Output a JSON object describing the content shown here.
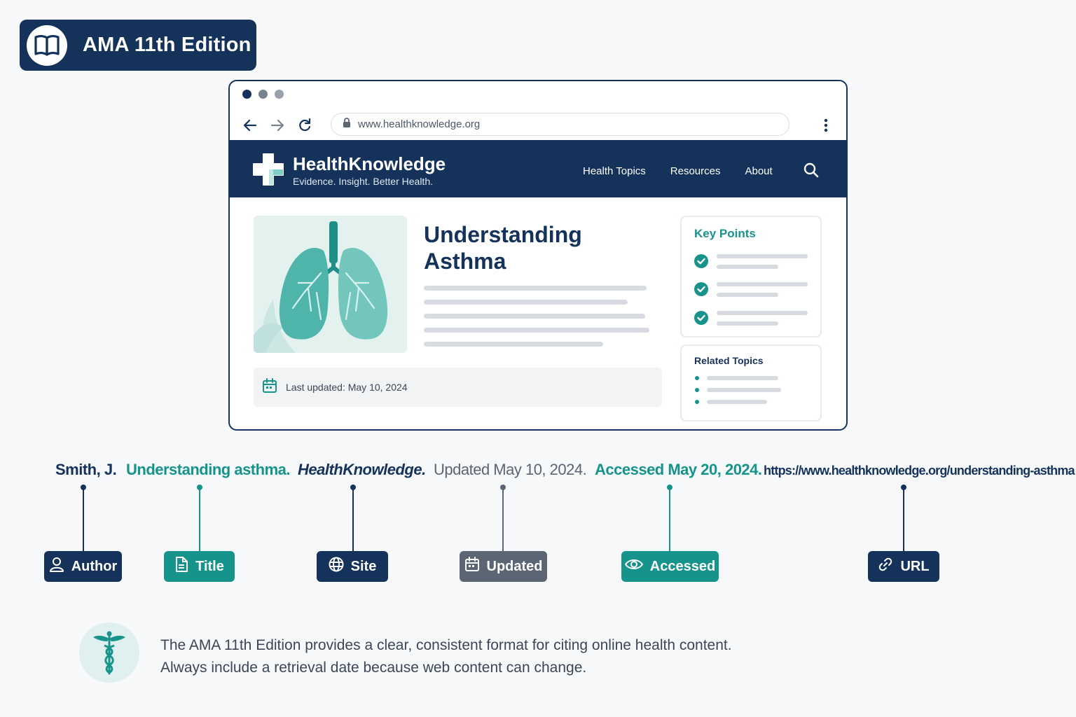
{
  "edition_badge": {
    "title": "AMA 11th Edition",
    "icon": "open-book-icon"
  },
  "browser": {
    "address": "www.healthknowledge.org",
    "icons": [
      "back-arrow-icon",
      "forward-arrow-icon",
      "reload-icon",
      "lock-icon",
      "more-vertical-icon"
    ]
  },
  "site": {
    "name": "HealthKnowledge",
    "tagline": "Evidence. Insight. Better Health.",
    "nav": [
      "Health Topics",
      "Resources",
      "About"
    ]
  },
  "article": {
    "title": "Understanding Asthma",
    "last_updated": "Last updated: May 10, 2024"
  },
  "sidebar": {
    "key_points_title": "Key Points",
    "related_topics_title": "Related Topics"
  },
  "citation": {
    "author": "Smith, J.",
    "title": "Understanding asthma.",
    "site": "HealthKnowledge.",
    "updated": "Updated May 10, 2024.",
    "accessed": "Accessed May 20, 2024.",
    "url": "https://www.healthknowledge.org/understanding-asthma"
  },
  "tags": {
    "author": "Author",
    "title": "Title",
    "site": "Site",
    "updated": "Updated",
    "accessed": "Accessed",
    "url": "URL"
  },
  "note": {
    "line1": "The AMA 11th Edition provides a clear, consistent format for citing online health content.",
    "line2": "Always include a retrieval date because web content can change.",
    "icon": "caduceus-icon"
  },
  "colors": {
    "navy": "#14325a",
    "teal": "#16938a",
    "gray": "#5b6573"
  }
}
